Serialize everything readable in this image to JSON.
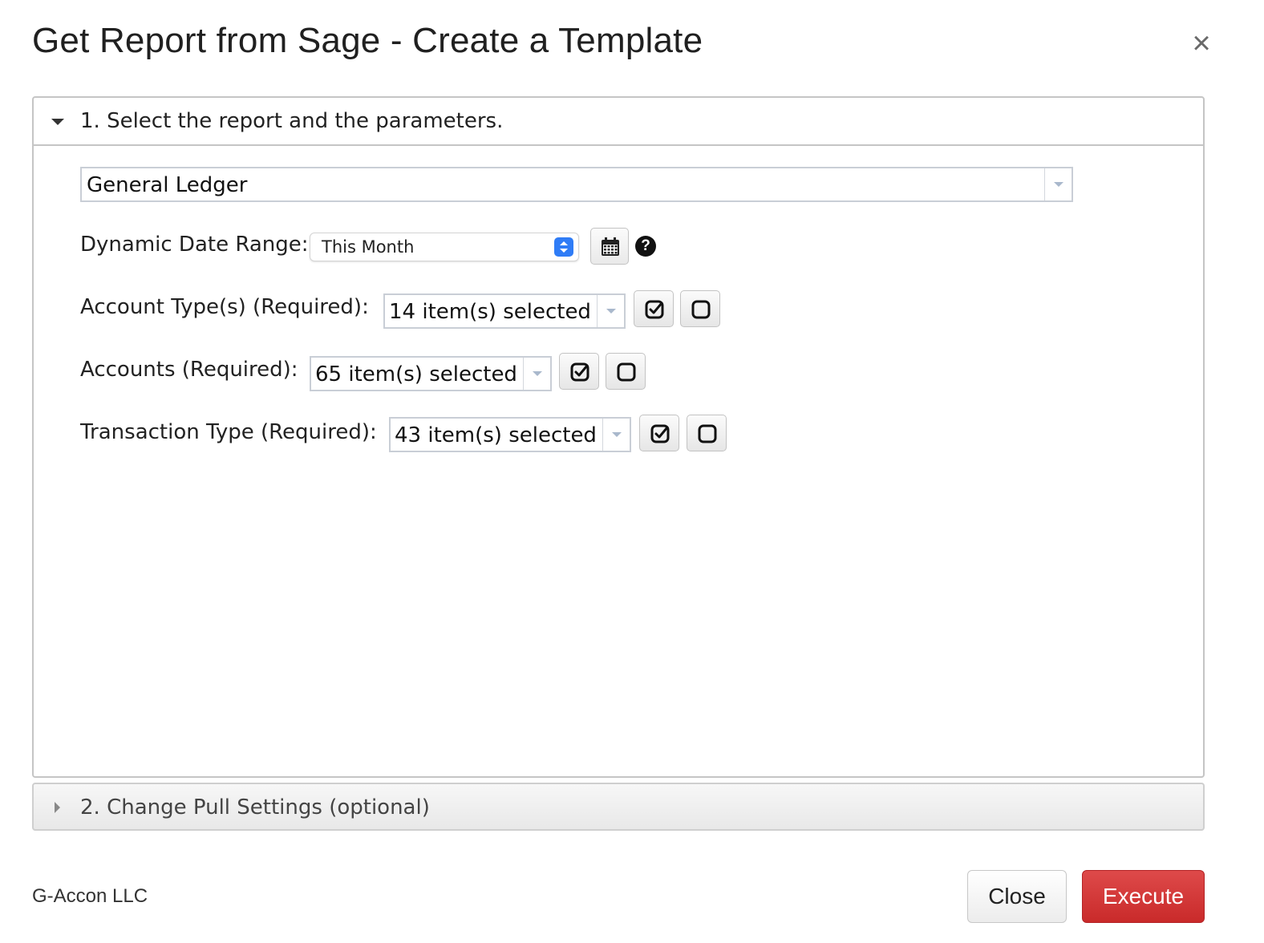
{
  "dialog": {
    "title": "Get Report from Sage - Create a Template",
    "close_icon": "close-icon"
  },
  "section1": {
    "title": "1. Select the report and the parameters.",
    "report": {
      "value": "General Ledger"
    },
    "date_range": {
      "label": "Dynamic Date Range:",
      "value": "This Month",
      "help_symbol": "?"
    },
    "account_types": {
      "label": "Account Type(s) (Required):",
      "value": "14 item(s) selected"
    },
    "accounts": {
      "label": "Accounts (Required):",
      "value": "65 item(s) selected"
    },
    "transaction_type": {
      "label": "Transaction Type (Required):",
      "value": "43 item(s) selected"
    },
    "icons": [
      "calendar-icon",
      "help-icon",
      "select-all-icon",
      "deselect-all-icon",
      "chevron-down-icon"
    ]
  },
  "section2": {
    "title": "2. Change Pull Settings (optional)"
  },
  "footer": {
    "brand": "G-Accon LLC",
    "close_label": "Close",
    "execute_label": "Execute"
  },
  "colors": {
    "execute_bg": "#d33b3b",
    "stepper_blue": "#2f7cf6",
    "border": "#c5c5c5"
  }
}
